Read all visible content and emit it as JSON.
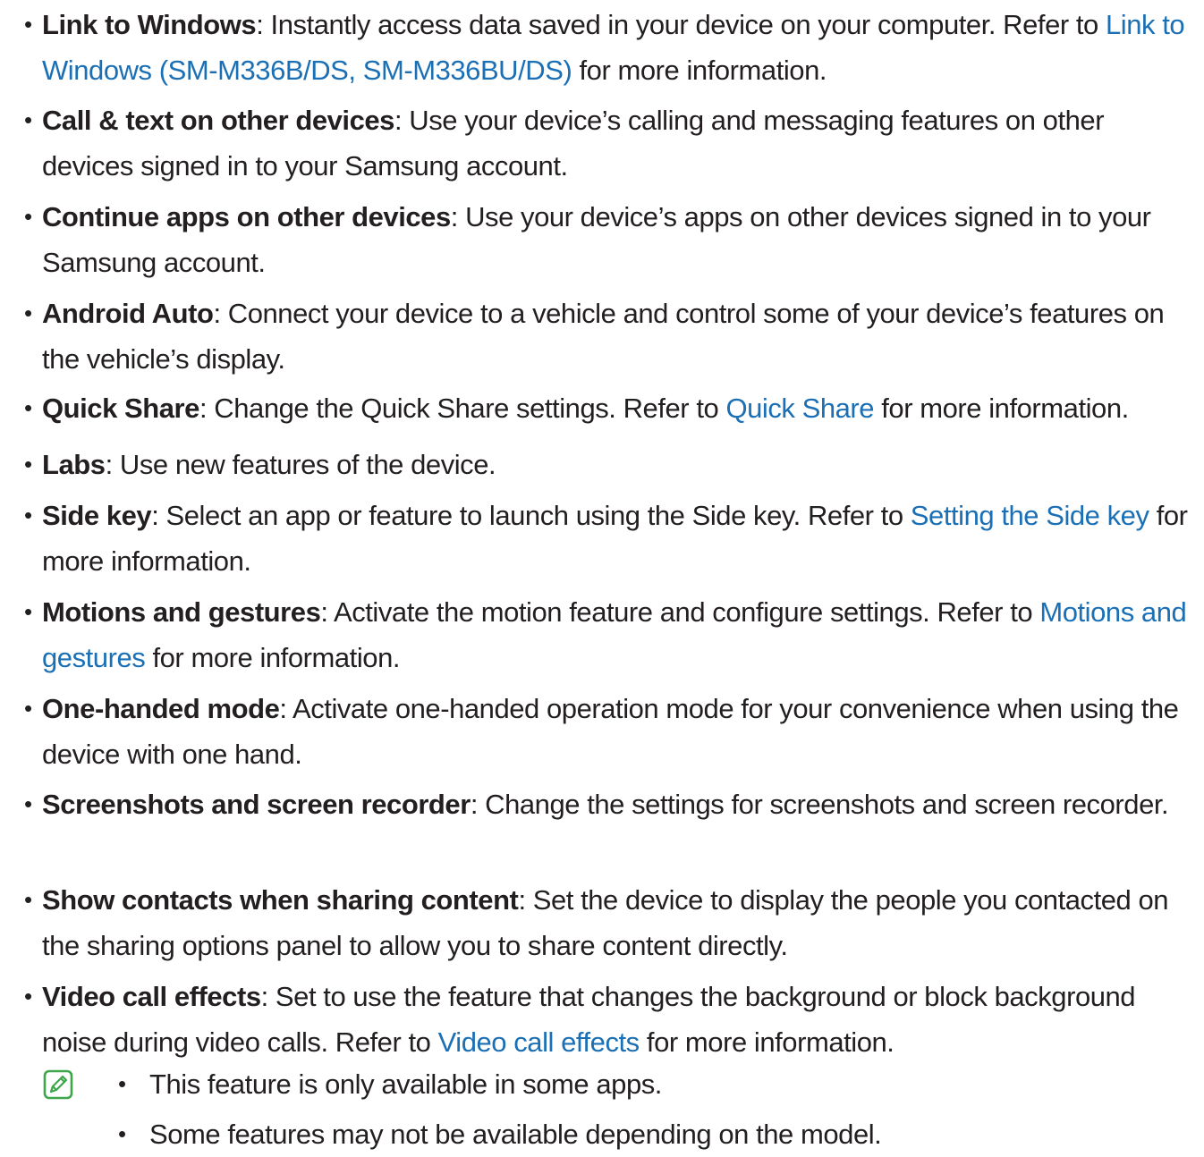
{
  "items": [
    {
      "term": "Link to Windows",
      "text": ": Instantly access data saved in your device on your computer. Refer to ",
      "link": "Link to Windows (SM-M336B/DS, SM-M336BU/DS)",
      "after": " for more information."
    },
    {
      "term": "Call & text on other devices",
      "text": ": Use your device’s calling and messaging features on other devices signed in to your Samsung account."
    },
    {
      "term": "Continue apps on other devices",
      "text": ": Use your device’s apps on other devices signed in to your Samsung account."
    },
    {
      "term": "Android Auto",
      "text": ": Connect your device to a vehicle and control some of your device’s features on the vehicle’s display."
    },
    {
      "term": "Quick Share",
      "text": ": Change the Quick Share settings. Refer to ",
      "link": "Quick Share",
      "after": " for more information."
    },
    {
      "term": "Labs",
      "text": ": Use new features of the device."
    },
    {
      "term": "Side key",
      "text": ": Select an app or feature to launch using the Side key. Refer to ",
      "link": "Setting the Side key",
      "after": " for more information."
    },
    {
      "term": "Motions and gestures",
      "text": ": Activate the motion feature and configure settings. Refer to ",
      "link": "Motions and gestures",
      "after": " for more information."
    },
    {
      "term": "One-handed mode",
      "text": ": Activate one-handed operation mode for your convenience when using the device with one hand."
    },
    {
      "term": "Screenshots and screen recorder",
      "text": ": Change the settings for screenshots and screen recorder."
    },
    {
      "term": "Show contacts when sharing content",
      "text": ": Set the device to display the people you contacted on the sharing options panel to allow you to share content directly."
    },
    {
      "term": "Video call effects",
      "text": ": Set to use the feature that changes the background or block background noise during video calls. Refer to ",
      "link": "Video call effects",
      "after": " for more information."
    }
  ],
  "bullet_glyph": "•",
  "note": {
    "icon": "note-pencil-icon",
    "items": [
      "This feature is only available in some apps.",
      "Some features may not be available depending on the model."
    ]
  },
  "colors": {
    "text": "#231f20",
    "link": "#1a6fb5",
    "note_icon": "#3ea64a"
  }
}
